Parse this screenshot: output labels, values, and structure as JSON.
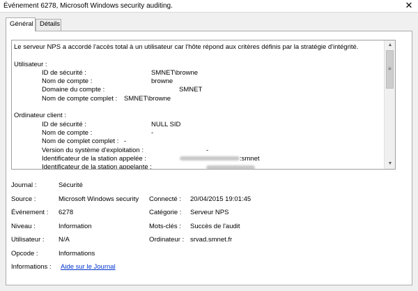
{
  "window": {
    "title": "Événement 6278, Microsoft Windows security auditing.",
    "close_glyph": "✕"
  },
  "tabs": [
    {
      "label": "Général",
      "active": true
    },
    {
      "label": "Détails",
      "active": false
    }
  ],
  "description": {
    "intro": "Le serveur NPS a accordé l'accès total à un utilisateur car l'hôte répond aux critères définis par la stratégie d'intégrité.",
    "user_section": "Utilisateur :",
    "user_fields": [
      {
        "key": "ID de sécurité :",
        "value": "SMNET\\browne"
      },
      {
        "key": "Nom de compte :",
        "value": "browne"
      },
      {
        "key": "Domaine du compte :",
        "value": "SMNET"
      },
      {
        "key": "Nom de compte complet :",
        "value": "SMNET\\browne"
      }
    ],
    "client_section": "Ordinateur client :",
    "client_fields": [
      {
        "key": "ID de sécurité :",
        "value": "NULL SID"
      },
      {
        "key": "Nom de compte :",
        "value": "-"
      },
      {
        "key": "Nom de complet complet :",
        "value": "-"
      },
      {
        "key": "Version du système d'exploitation :",
        "value": "-"
      },
      {
        "key": "Identificateur de la station appelée :",
        "value": ":smnet"
      },
      {
        "key": "Identificateur de la station appelante :",
        "value": ""
      }
    ]
  },
  "properties": {
    "journal_label": "Journal :",
    "journal_value": "Sécurité",
    "source_label": "Source :",
    "source_value": "Microsoft Windows security",
    "connecte_label": "Connecté :",
    "connecte_value": "20/04/2015 19:01:45",
    "event_label": "Événement :",
    "event_value": "6278",
    "category_label": "Catégorie :",
    "category_value": "Serveur NPS",
    "level_label": "Niveau :",
    "level_value": "Information",
    "keywords_label": "Mots-clés :",
    "keywords_value": "Succès de l'audit",
    "user_label": "Utilisateur :",
    "user_value": "N/A",
    "computer_label": "Ordinateur :",
    "computer_value": "srvad.smnet.fr",
    "opcode_label": "Opcode :",
    "opcode_value": "Informations",
    "info_label": "Informations :",
    "info_link": "Aide sur le Journal"
  }
}
